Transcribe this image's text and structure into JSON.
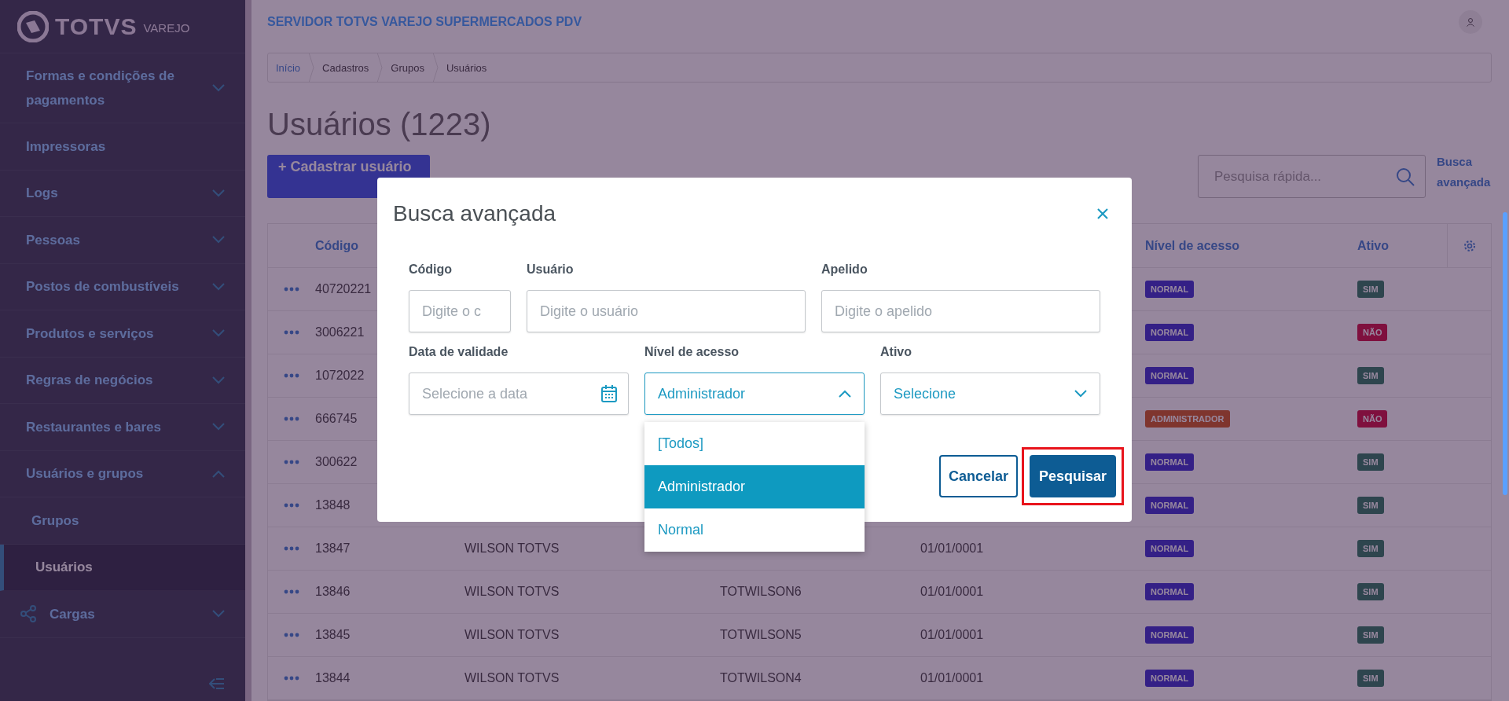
{
  "sidebar": {
    "logo": {
      "brand": "TOTVS",
      "product": "VAREJO"
    },
    "items": [
      {
        "label": "Formas e condições de pagamentos",
        "kind": "group",
        "expanded": false
      },
      {
        "label": "Impressoras",
        "kind": "link"
      },
      {
        "label": "Logs",
        "kind": "group",
        "expanded": false
      },
      {
        "label": "Pessoas",
        "kind": "group",
        "expanded": false
      },
      {
        "label": "Postos de combustíveis",
        "kind": "group",
        "expanded": false
      },
      {
        "label": "Produtos e serviços",
        "kind": "group",
        "expanded": false
      },
      {
        "label": "Regras de negócios",
        "kind": "group",
        "expanded": false
      },
      {
        "label": "Restaurantes e bares",
        "kind": "group",
        "expanded": false
      },
      {
        "label": "Usuários e grupos",
        "kind": "group",
        "expanded": true,
        "children": [
          {
            "label": "Grupos",
            "selected": false
          },
          {
            "label": "Usuários",
            "selected": true
          }
        ]
      },
      {
        "label": "Cargas",
        "kind": "icon_group",
        "expanded": false
      }
    ]
  },
  "header": {
    "title": "SERVIDOR TOTVS VAREJO SUPERMERCADOS PDV"
  },
  "breadcrumb": [
    "Início",
    "Cadastros",
    "Grupos",
    "Usuários"
  ],
  "page": {
    "title": "Usuários (1223)",
    "add_button": {
      "icon": "+",
      "label": "Cadastrar usuário"
    },
    "search": {
      "placeholder": "Pesquisa rápida..."
    },
    "advanced_link": "Busca avançada"
  },
  "table": {
    "columns": {
      "code": "Código",
      "access": "Nível de acesso",
      "active": "Ativo"
    },
    "rows": [
      {
        "code": "40720221",
        "access": {
          "text": "NORMAL",
          "kind": "normal"
        },
        "active": {
          "text": "SIM",
          "kind": "yes"
        }
      },
      {
        "code": "3006221",
        "access": {
          "text": "NORMAL",
          "kind": "normal"
        },
        "active": {
          "text": "NÃO",
          "kind": "no"
        }
      },
      {
        "code": "1072022",
        "access": {
          "text": "NORMAL",
          "kind": "normal"
        },
        "active": {
          "text": "SIM",
          "kind": "yes"
        }
      },
      {
        "code": "666745",
        "access": {
          "text": "ADMINISTRADOR",
          "kind": "admin"
        },
        "active": {
          "text": "NÃO",
          "kind": "no"
        }
      },
      {
        "code": "300622",
        "access": {
          "text": "NORMAL",
          "kind": "normal"
        },
        "active": {
          "text": "SIM",
          "kind": "yes"
        }
      },
      {
        "code": "13848",
        "access": {
          "text": "NORMAL",
          "kind": "normal"
        },
        "active": {
          "text": "SIM",
          "kind": "yes"
        }
      },
      {
        "code": "13847",
        "column_2": "WILSON TOTVS",
        "column_4": "01/01/0001",
        "access": {
          "text": "NORMAL",
          "kind": "normal"
        },
        "active": {
          "text": "SIM",
          "kind": "yes"
        }
      },
      {
        "code": "13846",
        "column_2": "WILSON TOTVS",
        "column_3": "TOTWILSON6",
        "column_4": "01/01/0001",
        "access": {
          "text": "NORMAL",
          "kind": "normal"
        },
        "active": {
          "text": "SIM",
          "kind": "yes"
        }
      },
      {
        "code": "13845",
        "column_2": "WILSON TOTVS",
        "column_3": "TOTWILSON5",
        "column_4": "01/01/0001",
        "access": {
          "text": "NORMAL",
          "kind": "normal"
        },
        "active": {
          "text": "SIM",
          "kind": "yes"
        }
      },
      {
        "code": "13844",
        "column_2": "WILSON TOTVS",
        "column_3": "TOTWILSON4",
        "column_4": "01/01/0001",
        "access": {
          "text": "NORMAL",
          "kind": "normal"
        },
        "active": {
          "text": "SIM",
          "kind": "yes"
        }
      }
    ]
  },
  "modal": {
    "title": "Busca avançada",
    "rows": [
      [
        {
          "label": "Código",
          "kind": "text",
          "placeholder": "Digite o c"
        },
        {
          "label": "Usuário",
          "kind": "text",
          "placeholder": "Digite o usuário"
        },
        {
          "label": "Apelido",
          "kind": "text",
          "placeholder": "Digite o apelido"
        }
      ],
      [
        {
          "label": "Data de validade",
          "kind": "date",
          "placeholder": "Selecione a data"
        },
        {
          "label": "Nível de acesso",
          "kind": "select",
          "value": "Administrador",
          "expanded": true,
          "options": [
            {
              "label": "[Todos]",
              "selected": false
            },
            {
              "label": "Administrador",
              "selected": true
            },
            {
              "label": "Normal",
              "selected": false
            }
          ]
        },
        {
          "label": "Ativo",
          "kind": "select",
          "value": "Selecione",
          "expanded": false
        }
      ]
    ],
    "buttons": [
      {
        "label": "Cancelar",
        "kind": "secondary",
        "highlighted": false
      },
      {
        "label": "Pesquisar",
        "kind": "primary",
        "highlighted": true
      }
    ]
  }
}
